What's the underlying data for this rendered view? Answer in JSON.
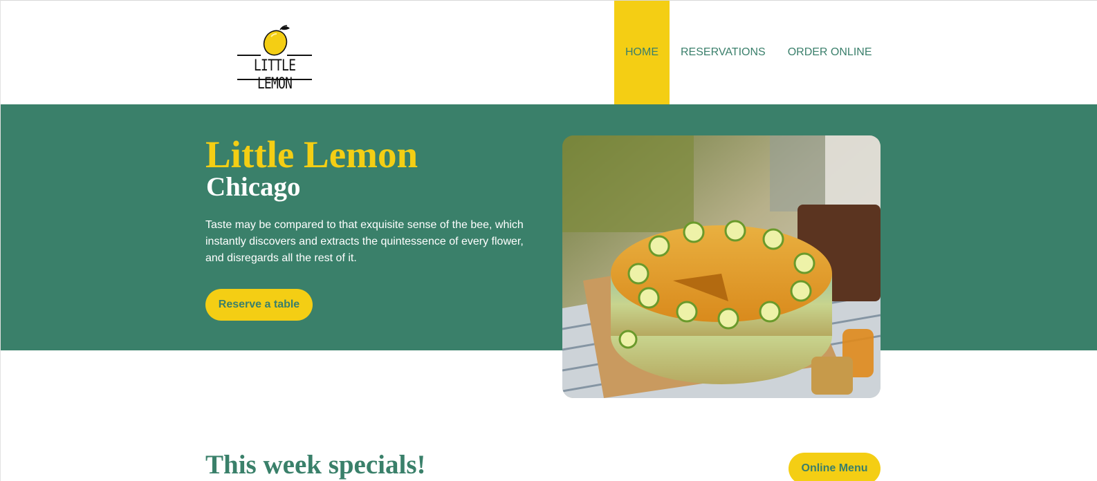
{
  "brand": {
    "logo_text": "LITTLE LEMON"
  },
  "nav": {
    "items": [
      {
        "label": "HOME",
        "active": true
      },
      {
        "label": "RESERVATIONS",
        "active": false
      },
      {
        "label": "ORDER ONLINE",
        "active": false
      }
    ]
  },
  "hero": {
    "title": "Little Lemon",
    "subtitle": "Chicago",
    "description": "Taste may be compared to that exquisite sense of the bee, which instantly discovers and extracts the quintessence of every flower, and disregards all the rest of it.",
    "cta_label": "Reserve a table",
    "image_icon": "lemon-crepe-cake-photo"
  },
  "specials": {
    "title": "This week specials!",
    "menu_button_label": "Online Menu"
  },
  "colors": {
    "primary_green": "#3a806a",
    "accent_yellow": "#f4ce14",
    "white": "#ffffff"
  }
}
